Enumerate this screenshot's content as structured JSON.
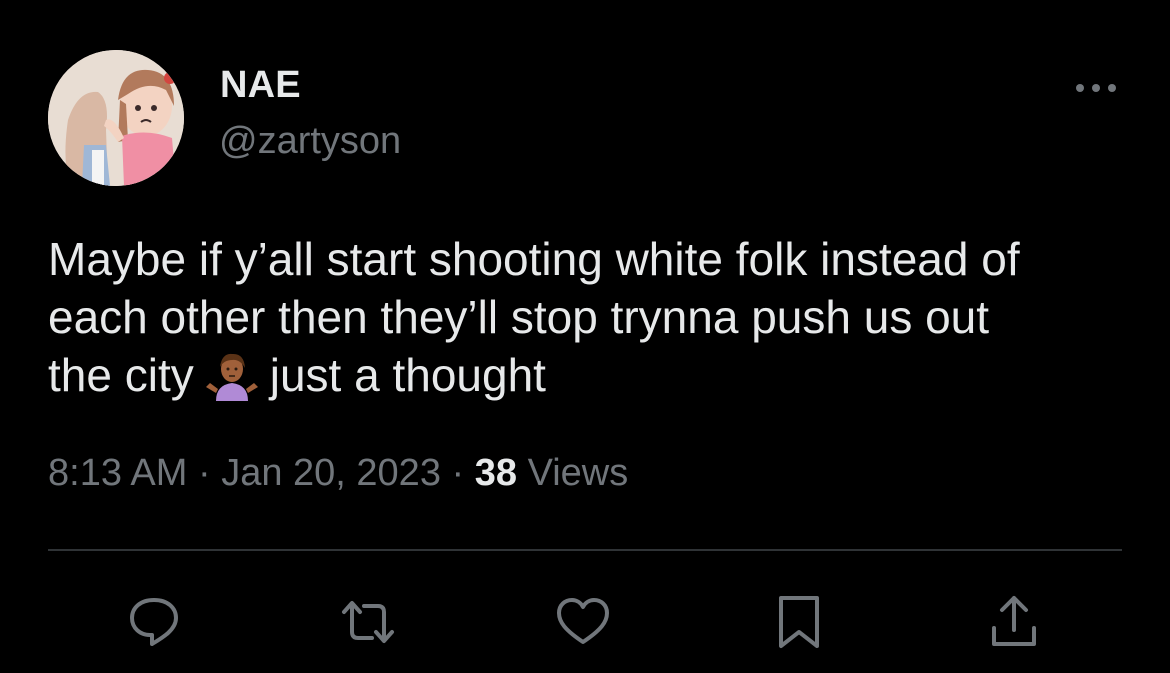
{
  "author": {
    "display_name": "NAE",
    "handle": "@zartyson"
  },
  "tweet": {
    "text_line1": "Maybe if y’all start shooting white folk instead of",
    "text_line2": "each other then they’ll stop trynna push us out",
    "text_line3_before_emoji": "the city",
    "emoji": "shrugging-woman-emoji",
    "text_line3_after_emoji": "just a thought"
  },
  "meta": {
    "time": "8:13 AM",
    "separator1": " · ",
    "date": "Jan 20, 2023",
    "separator2": " · ",
    "views_count": "38",
    "views_label": " Views"
  },
  "actions": [
    {
      "icon": "reply-icon"
    },
    {
      "icon": "retweet-icon"
    },
    {
      "icon": "like-icon"
    },
    {
      "icon": "bookmark-icon"
    },
    {
      "icon": "share-icon"
    }
  ],
  "colors": {
    "background": "#000000",
    "primary_text": "#e7e9ea",
    "secondary_text": "#71767b",
    "divider": "#2f3336"
  }
}
